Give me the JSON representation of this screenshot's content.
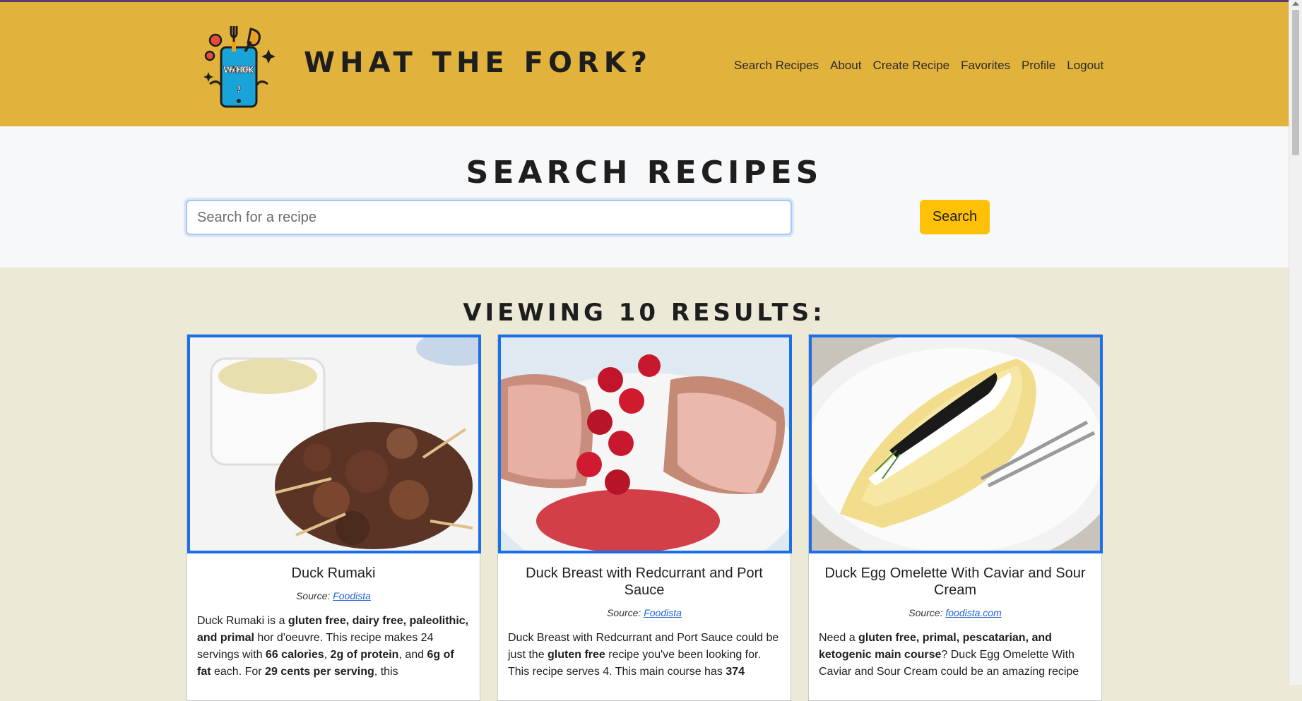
{
  "header": {
    "brand": "WHAT THE FORK?",
    "logo_text": "WHAT THE FORK",
    "nav": [
      "Search Recipes",
      "About",
      "Create Recipe",
      "Favorites",
      "Profile",
      "Logout"
    ]
  },
  "search": {
    "title": "SEARCH RECIPES",
    "placeholder": "Search for a recipe",
    "button_label": "Search"
  },
  "results": {
    "title": "VIEWING 10 RESULTS:",
    "source_label": "Source:",
    "cards": [
      {
        "title": "Duck Rumaki",
        "source": "Foodista",
        "desc": [
          [
            "Duck Rumaki is a ",
            ""
          ],
          [
            "gluten free, dairy free, paleolithic, and primal",
            "b"
          ],
          [
            " hor d'oeuvre. This recipe makes 24 servings with ",
            ""
          ],
          [
            "66 calories",
            "b"
          ],
          [
            ", ",
            ""
          ],
          [
            "2g of protein",
            "b"
          ],
          [
            ", and ",
            ""
          ],
          [
            "6g of fat",
            "b"
          ],
          [
            " each. For ",
            ""
          ],
          [
            "29 cents per serving",
            "b"
          ],
          [
            ", this",
            ""
          ]
        ]
      },
      {
        "title": "Duck Breast with Redcurrant and Port Sauce",
        "source": "Foodista",
        "desc": [
          [
            "Duck Breast with Redcurrant and Port Sauce could be just the ",
            ""
          ],
          [
            "gluten free",
            "b"
          ],
          [
            " recipe you've been looking for. This recipe serves 4. This main course has ",
            ""
          ],
          [
            "374",
            "b"
          ]
        ]
      },
      {
        "title": "Duck Egg Omelette With Caviar and Sour Cream",
        "source": "foodista.com",
        "desc": [
          [
            "Need a ",
            ""
          ],
          [
            "gluten free, primal, pescatarian, and ketogenic main course",
            "b"
          ],
          [
            "? Duck Egg Omelette With Caviar and Sour Cream could be an amazing recipe",
            ""
          ]
        ]
      }
    ]
  },
  "colors": {
    "header_bg": "#e2b33c",
    "search_bg": "#f7f8fa",
    "results_bg": "#ece9d7",
    "accent_button": "#ffc107",
    "card_image_border": "#1b6fe8",
    "link": "#2165d6"
  }
}
